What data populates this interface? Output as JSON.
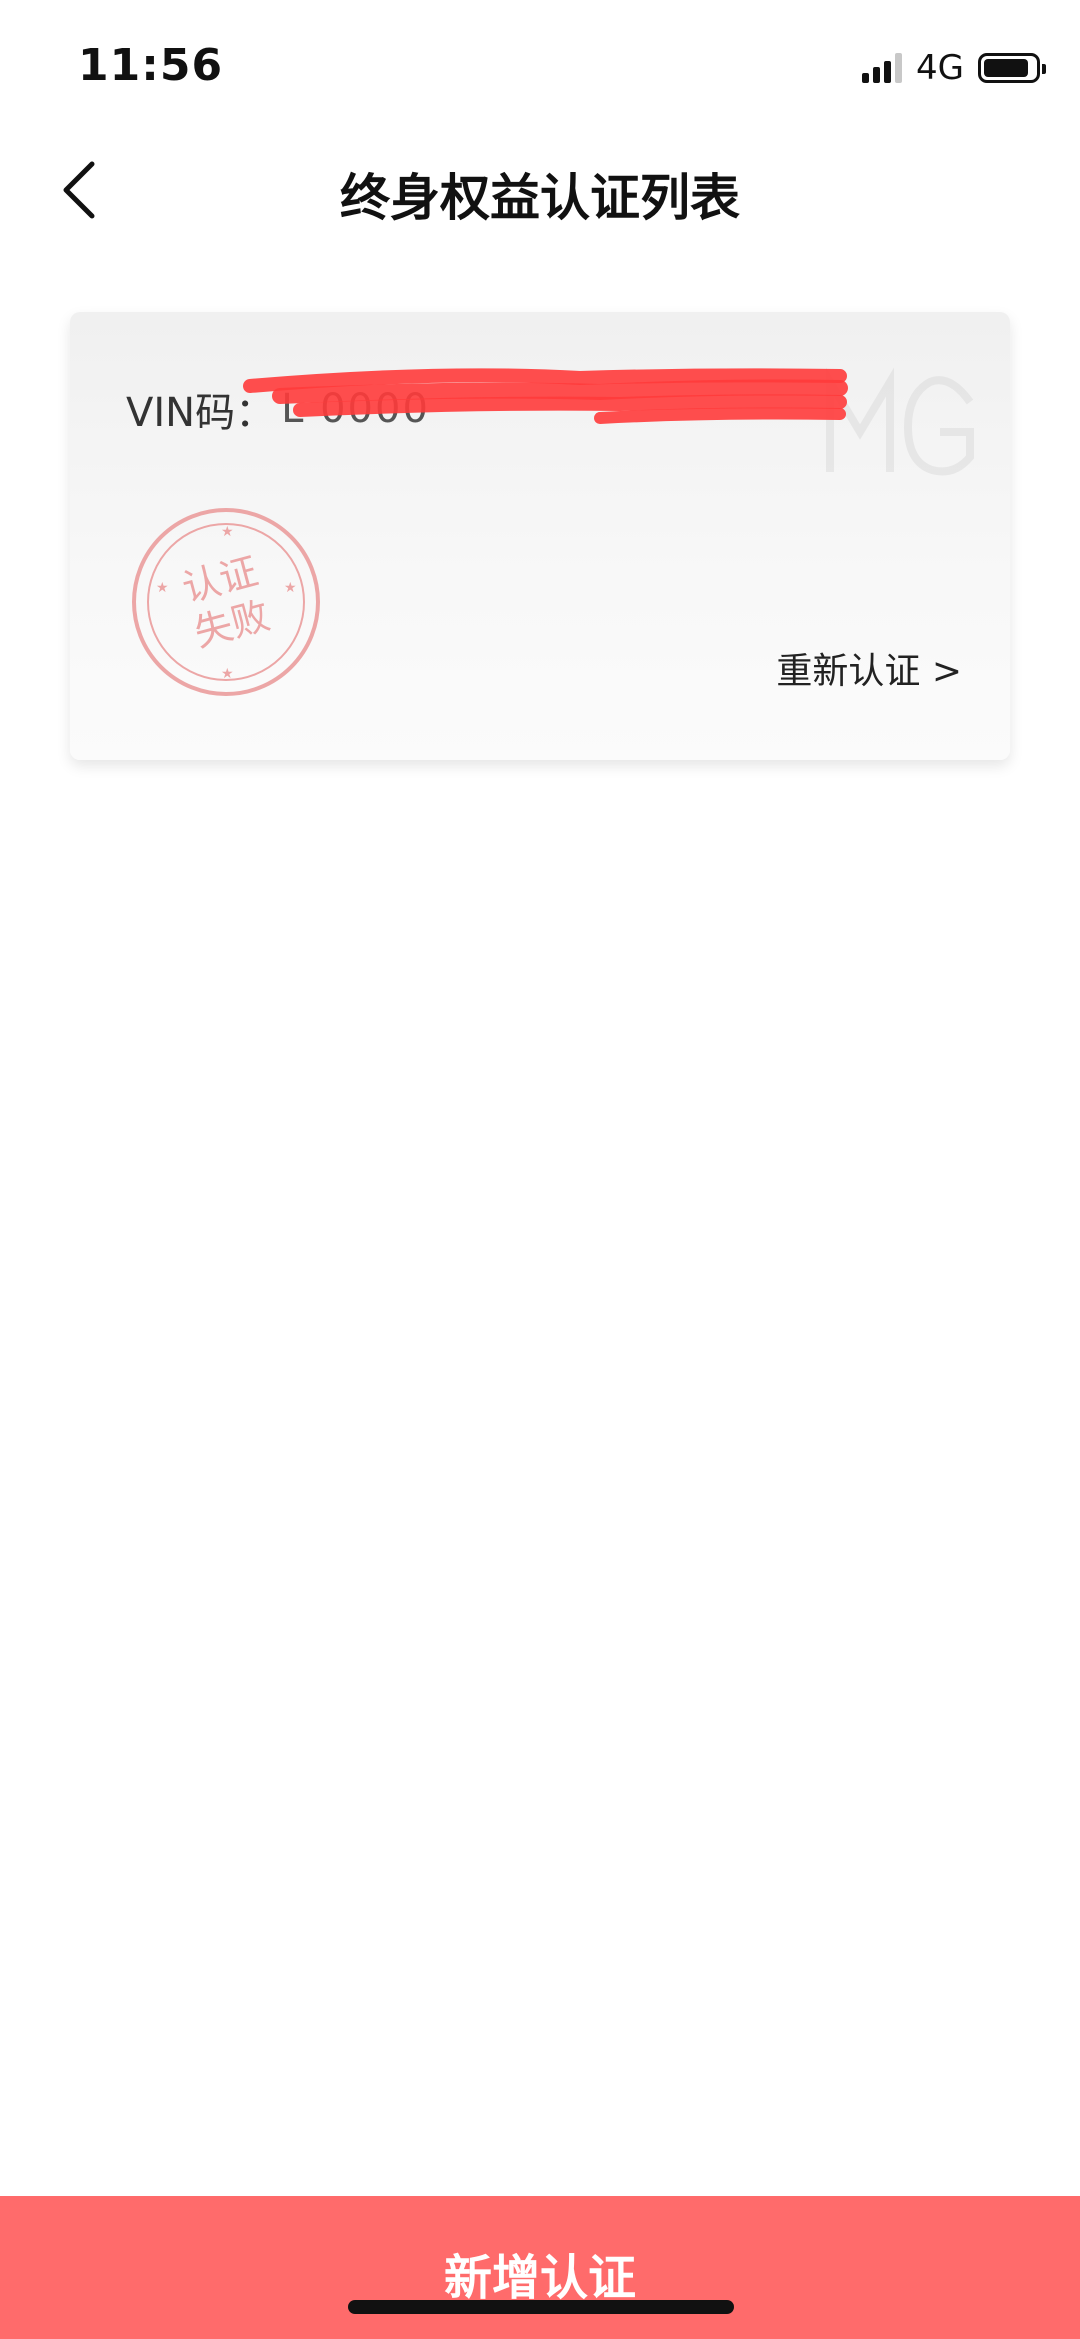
{
  "status_bar": {
    "time": "11:56",
    "network": "4G",
    "icons": [
      "signal-icon",
      "battery-icon"
    ]
  },
  "nav": {
    "back_icon": "chevron-left-icon",
    "title": "终身权益认证列表"
  },
  "card": {
    "vin_label": "VIN码：",
    "vin_value": "L     0000",
    "stamp_text": "认证\n失败",
    "reverify_label": "重新认证 >",
    "logo": "mg-logo"
  },
  "footer": {
    "add_label": "新增认证"
  },
  "colors": {
    "accent": "#ff6b6b",
    "stamp": "#eca6a6",
    "redaction": "#ff3b3b"
  }
}
